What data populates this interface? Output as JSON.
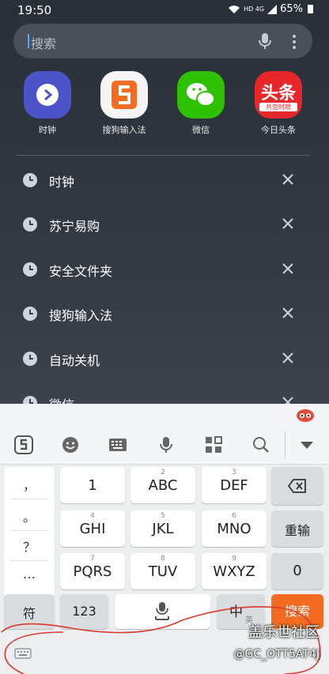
{
  "status": {
    "time": "19:50",
    "network": "HD 4G",
    "battery": "65%"
  },
  "search": {
    "placeholder": "搜索"
  },
  "apps": [
    {
      "label": "时钟"
    },
    {
      "label": "搜狗输入法"
    },
    {
      "label": "微信"
    },
    {
      "label": "今日头条",
      "icon_text": "头条",
      "icon_sub": "共克时艰"
    }
  ],
  "history": [
    "时钟",
    "苏宁易购",
    "安全文件夹",
    "搜狗输入法",
    "自动关机",
    "微信"
  ],
  "keyboard": {
    "punct": [
      "，",
      "。",
      "？",
      "…"
    ],
    "keys": [
      {
        "main": "1",
        "sub": ""
      },
      {
        "main": "ABC",
        "sub": "2"
      },
      {
        "main": "DEF",
        "sub": "3"
      },
      {
        "main": "GHI",
        "sub": "4"
      },
      {
        "main": "JKL",
        "sub": "5"
      },
      {
        "main": "MNO",
        "sub": "6"
      },
      {
        "main": "PQRS",
        "sub": "7"
      },
      {
        "main": "TUV",
        "sub": "8"
      },
      {
        "main": "WXYZ",
        "sub": "9"
      }
    ],
    "rechoose": "重输",
    "zero": "0",
    "symbol": "符",
    "num123": "123",
    "lang": "中",
    "lang_sub": "英",
    "search": "搜索"
  },
  "watermark": {
    "line1": "盖乐世社区",
    "line2": "@GC_OTT5AT4J"
  },
  "colors": {
    "accent_orange": "#f36c21",
    "wechat_green": "#2dc100",
    "toutiao_red": "#e8272a",
    "clock_purple": "#4b53c9"
  }
}
